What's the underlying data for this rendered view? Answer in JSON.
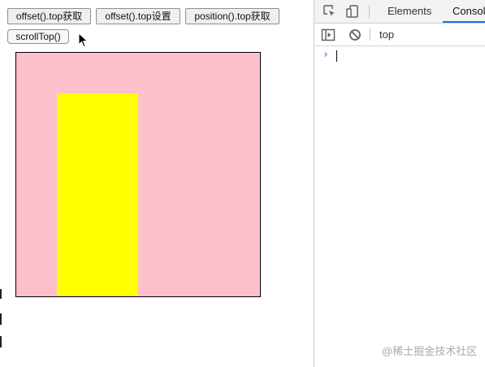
{
  "toolbar": {
    "btn_offset_top_get": "offset().top获取",
    "btn_offset_top_set": "offset().top设置",
    "btn_position_top_get": "position().top获取",
    "btn_scroll_top": "scrollTop()"
  },
  "demo": {
    "outer_color": "#fbc0cb",
    "inner_color": "#ffff00"
  },
  "devtools": {
    "tabs": [
      "Elements",
      "Console"
    ],
    "active_tab": "Console",
    "context": "top",
    "prompt_symbol": "›"
  },
  "watermark": "@稀土掘金技术社区"
}
